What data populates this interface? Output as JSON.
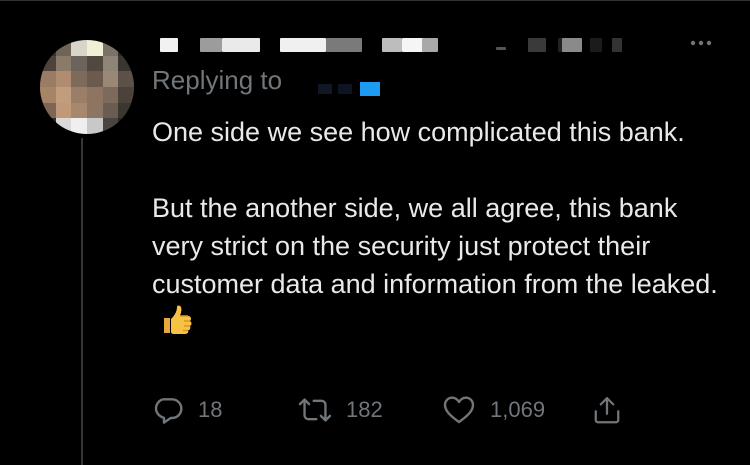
{
  "tweet": {
    "replying_label": "Replying to",
    "paragraphs": [
      "One side we see how complicated this bank.",
      "But the another side, we all agree, this bank very strict on the security just protect their customer data and information from the leaked."
    ],
    "emoji": "thumbs-up",
    "replies": "18",
    "retweets": "182",
    "likes": "1,069"
  },
  "icons": {
    "reply": "reply-icon",
    "retweet": "retweet-icon",
    "like": "heart-icon",
    "share": "share-icon",
    "more": "more-icon"
  },
  "colors": {
    "background": "#000000",
    "text": "#e7e9ea",
    "secondary": "#71767b",
    "link_accent": "#1d9bf0",
    "thread_line": "#333639"
  }
}
